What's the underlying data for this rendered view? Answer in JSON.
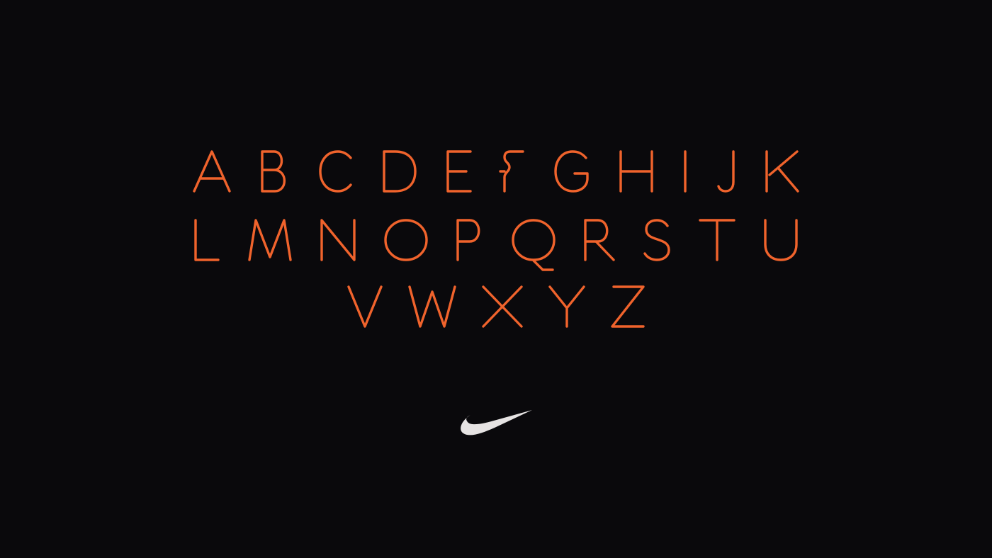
{
  "alphabet": {
    "rows": [
      [
        "A",
        "B",
        "C",
        "D",
        "E",
        "F",
        "G",
        "H",
        "I",
        "J",
        "K"
      ],
      [
        "L",
        "M",
        "N",
        "O",
        "P",
        "Q",
        "R",
        "S",
        "T",
        "U"
      ],
      [
        "V",
        "W",
        "X",
        "Y",
        "Z"
      ]
    ],
    "gradient": [
      "#f0632c",
      "#f23a5d"
    ]
  },
  "background_color": "#0a090c",
  "logo": {
    "icon": "swoosh-logo-icon",
    "color": "#e6e3e3"
  }
}
